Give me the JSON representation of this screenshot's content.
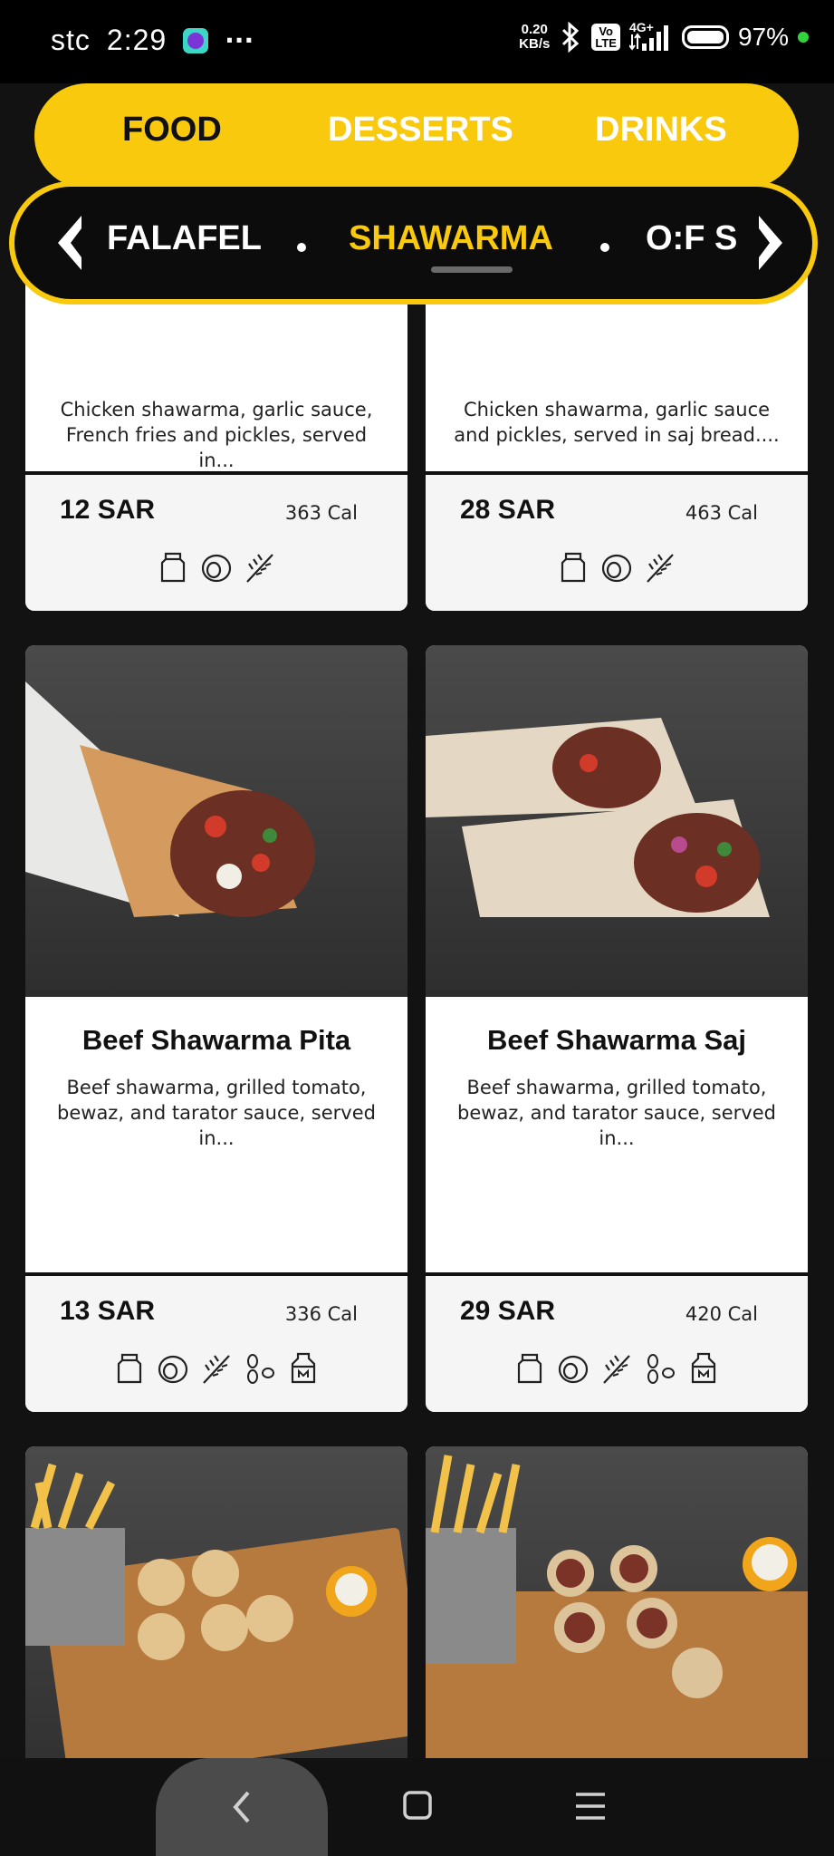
{
  "status": {
    "carrier": "stc",
    "time": "2:29",
    "more": "···",
    "speed_value": "0.20",
    "speed_unit": "KB/s",
    "volte_top": "Vo",
    "volte_bottom": "LTE",
    "network": "4G+",
    "battery": "97%"
  },
  "categories": {
    "tabs": [
      "FOOD",
      "DESSERTS",
      "DRINKS"
    ],
    "active": "FOOD"
  },
  "subcategories": {
    "items": [
      "FALAFEL",
      "SHAWARMA",
      "O:F S"
    ],
    "active": "SHAWARMA"
  },
  "products": [
    {
      "desc": "Chicken shawarma, garlic sauce, French fries and pickles, served in...",
      "price": "12 SAR",
      "calories": "363 Cal",
      "allergens": [
        "jar-icon",
        "egg-icon",
        "wheat-icon"
      ]
    },
    {
      "desc": "Chicken shawarma, garlic sauce and pickles, served in saj bread....",
      "price": "28 SAR",
      "calories": "463 Cal",
      "allergens": [
        "jar-icon",
        "egg-icon",
        "wheat-icon"
      ]
    },
    {
      "name": "Beef Shawarma Pita",
      "desc": "Beef shawarma, grilled tomato, bewaz, and tarator sauce, served in...",
      "price": "13 SAR",
      "calories": "336 Cal",
      "allergens": [
        "jar-icon",
        "egg-icon",
        "wheat-icon",
        "seeds-icon",
        "milk-icon"
      ]
    },
    {
      "name": "Beef Shawarma Saj",
      "desc": "Beef shawarma, grilled tomato, bewaz, and tarator sauce, served in...",
      "price": "29 SAR",
      "calories": "420 Cal",
      "allergens": [
        "jar-icon",
        "egg-icon",
        "wheat-icon",
        "seeds-icon",
        "milk-icon"
      ]
    }
  ],
  "colors": {
    "accent": "#f8c90c",
    "background": "#121212"
  }
}
